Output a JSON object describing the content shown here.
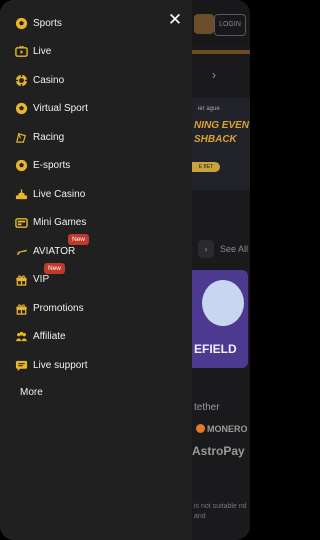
{
  "accent_color": "#e8b62a",
  "drawer": {
    "close_icon": "close-icon",
    "items": [
      {
        "label": "Sports",
        "icon": "soccer-ball-icon"
      },
      {
        "label": "Live",
        "icon": "live-tv-icon"
      },
      {
        "label": "Casino",
        "icon": "casino-chip-icon"
      },
      {
        "label": "Virtual Sport",
        "icon": "soccer-ball-icon"
      },
      {
        "label": "Racing",
        "icon": "racing-flag-icon"
      },
      {
        "label": "E-sports",
        "icon": "soccer-ball-icon"
      },
      {
        "label": "Live Casino",
        "icon": "live-casino-icon"
      },
      {
        "label": "Mini Games",
        "icon": "mini-games-icon"
      },
      {
        "label": "AVIATOR",
        "icon": "plane-icon",
        "badge": "New"
      },
      {
        "label": "VIP",
        "icon": "gift-icon",
        "badge": "New"
      },
      {
        "label": "Promotions",
        "icon": "gift-icon"
      },
      {
        "label": "Affiliate",
        "icon": "affiliate-icon"
      },
      {
        "label": "Live support",
        "icon": "chat-icon"
      }
    ],
    "more_label": "More"
  },
  "background": {
    "login_label": "LOGIN",
    "promo_line1": "ier   ague",
    "promo_line2": "NING EVEN",
    "promo_line3": "SHBACK",
    "promo_button": "E BET",
    "see_all": "See All",
    "game_title": "EFIELD",
    "payment_1": "tether",
    "payment_2": "MONERO",
    "payment_3": "AstroPay",
    "fine_print": "is not suitable nd and"
  }
}
